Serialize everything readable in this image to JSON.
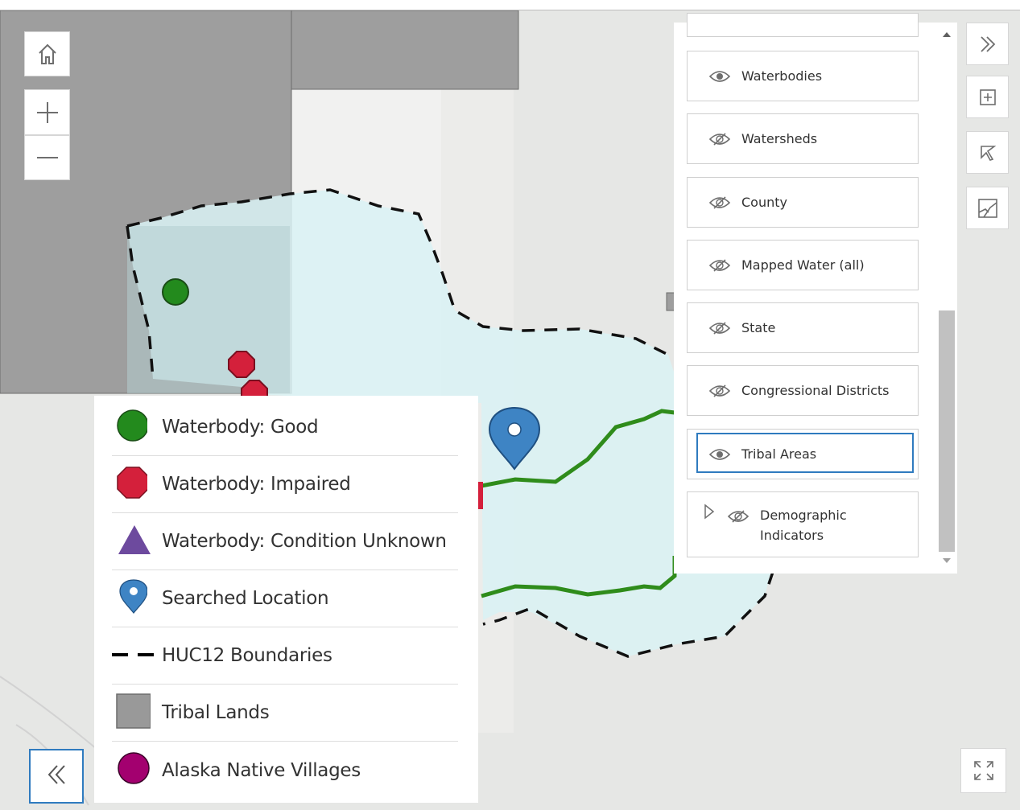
{
  "map": {
    "home_button": "home-icon",
    "zoom_in": "plus-icon",
    "zoom_out": "minus-icon",
    "expand_button": "fullscreen-icon",
    "toolbar": [
      "double-chevron-right-icon",
      "add-layer-icon",
      "select-icon",
      "basemap-icon"
    ]
  },
  "legend": {
    "items": [
      {
        "label": "Waterbody: Good",
        "symbol": "green-circle",
        "color": "#238a1d"
      },
      {
        "label": "Waterbody: Impaired",
        "symbol": "red-octagon",
        "color": "#d4203b"
      },
      {
        "label": "Waterbody: Condition Unknown",
        "symbol": "purple-triangle",
        "color": "#6d4a9e"
      },
      {
        "label": "Searched Location",
        "symbol": "blue-pin",
        "color": "#3e84c4"
      },
      {
        "label": "HUC12 Boundaries",
        "symbol": "black-dashed-line",
        "color": "#000000"
      },
      {
        "label": "Tribal Lands",
        "symbol": "gray-square",
        "color": "#999999"
      },
      {
        "label": "Alaska Native Villages",
        "symbol": "magenta-circle",
        "color": "#a3006f"
      }
    ],
    "collapse_button": "double-chevron-left-icon"
  },
  "layer_list": {
    "items": [
      {
        "label": "Waterbodies",
        "visible": true
      },
      {
        "label": "Watersheds",
        "visible": false
      },
      {
        "label": "County",
        "visible": false
      },
      {
        "label": "Mapped Water (all)",
        "visible": false
      },
      {
        "label": "State",
        "visible": false
      },
      {
        "label": "Congressional Districts",
        "visible": false
      },
      {
        "label": "Tribal Areas",
        "visible": true,
        "selected": true
      },
      {
        "label": "Demographic Indicators",
        "visible": false,
        "expandable": true
      }
    ]
  },
  "colors": {
    "accent": "#2f7bbf",
    "huc_fill": "#d8f2f4",
    "tribal_fill": "#9b9b9b",
    "stream": "#2f8c1b"
  }
}
